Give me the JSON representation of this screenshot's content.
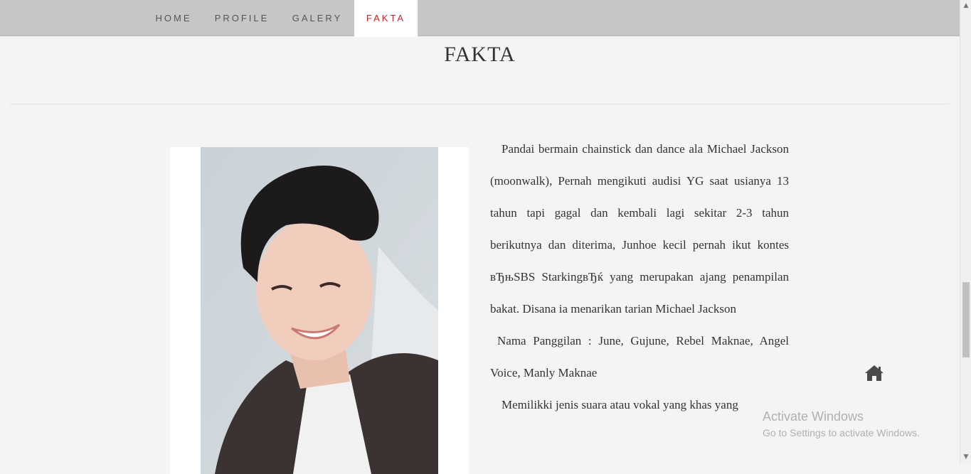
{
  "nav": {
    "items": [
      {
        "label": "HOME"
      },
      {
        "label": "PROFILE"
      },
      {
        "label": "GALERY"
      },
      {
        "label": "FAKTA"
      }
    ],
    "active": "FAKTA",
    "active_color": "#c0272d"
  },
  "page": {
    "title": "FAKTA"
  },
  "facts": [
    "Pandai bermain chainstick dan dance ala Michael Jackson (moonwalk), Pernah mengikuti audisi YG saat usianya 13 tahun tapi gagal dan kembali lagi sekitar 2-3 tahun berikutnya dan diterima, Junhoe kecil pernah ikut kontes вЂњSBS StarkingвЂќ yang merupakan ajang penampilan bakat. Disana ia menarikan tarian Michael Jackson",
    "Nama Panggilan : June, Gujune, Rebel Maknae, Angel Voice, Manly Maknae",
    "Memilikki jenis suara atau vokal yang khas yang"
  ],
  "icons": {
    "home": "home-icon"
  },
  "watermark": {
    "title": "Activate Windows",
    "subtitle": "Go to Settings to activate Windows."
  }
}
